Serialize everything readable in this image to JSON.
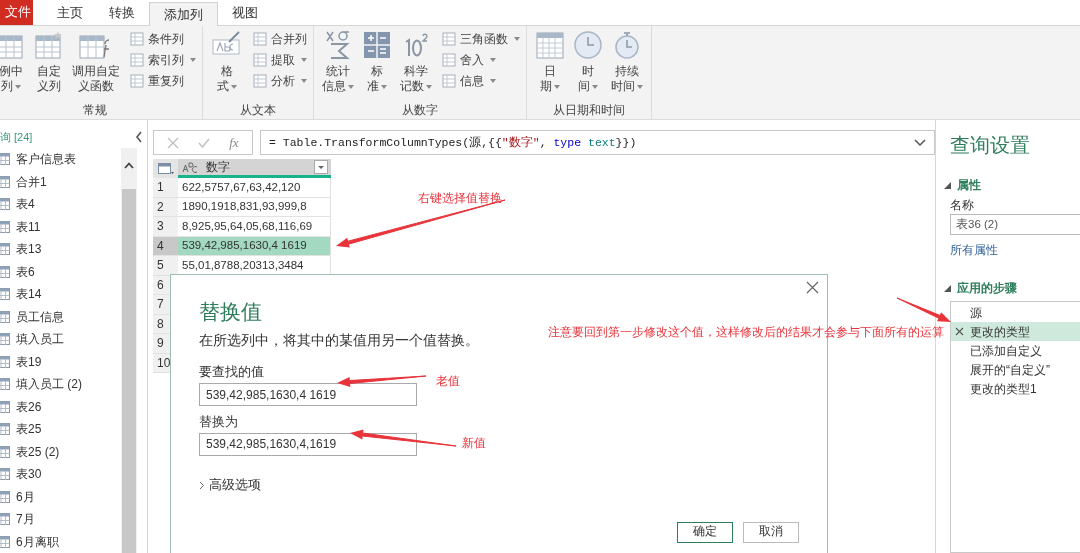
{
  "tabs": [
    {
      "label": "文件",
      "kind": "file",
      "selected": false
    },
    {
      "label": "主页",
      "kind": "tab",
      "selected": false
    },
    {
      "label": "转换",
      "kind": "tab",
      "selected": false
    },
    {
      "label": "添加列",
      "kind": "tab",
      "selected": true
    },
    {
      "label": "视图",
      "kind": "tab",
      "selected": false
    }
  ],
  "ribbon": {
    "groups": [
      {
        "label": "常规",
        "items": [
          {
            "kind": "large",
            "lines": [
              "例中",
              "列"
            ],
            "dropdown": true
          },
          {
            "kind": "large",
            "lines": [
              "自定",
              "义列"
            ],
            "dropdown": false
          },
          {
            "kind": "large",
            "lines": [
              "调用自定",
              "义函数"
            ],
            "dropdown": false
          },
          {
            "kind": "stack",
            "items": [
              {
                "label": "条件列",
                "dropdown": false
              },
              {
                "label": "索引列",
                "dropdown": true
              },
              {
                "label": "重复列",
                "dropdown": false
              }
            ]
          }
        ]
      },
      {
        "label": "从文本",
        "items": [
          {
            "kind": "large",
            "lines": [
              "格",
              "式"
            ],
            "dropdown": true
          },
          {
            "kind": "stack",
            "items": [
              {
                "label": "合并列",
                "dropdown": false
              },
              {
                "label": "提取",
                "dropdown": true
              },
              {
                "label": "分析",
                "dropdown": true
              }
            ]
          }
        ]
      },
      {
        "label": "从数字",
        "items": [
          {
            "kind": "large",
            "lines": [
              "统计",
              "信息"
            ],
            "dropdown": true
          },
          {
            "kind": "large",
            "lines": [
              "标",
              "准"
            ],
            "dropdown": true
          },
          {
            "kind": "large",
            "lines": [
              "科学",
              "记数"
            ],
            "dropdown": true
          },
          {
            "kind": "stack",
            "items": [
              {
                "label": "三角函数",
                "dropdown": true
              },
              {
                "label": "舍入",
                "dropdown": true
              },
              {
                "label": "信息",
                "dropdown": true
              }
            ]
          }
        ]
      },
      {
        "label": "从日期和时间",
        "items": [
          {
            "kind": "large",
            "lines": [
              "日",
              "期"
            ],
            "dropdown": true
          },
          {
            "kind": "large",
            "lines": [
              "时",
              "间"
            ],
            "dropdown": true
          },
          {
            "kind": "large",
            "lines": [
              "持续",
              "时间"
            ],
            "dropdown": true
          }
        ]
      }
    ]
  },
  "queries": {
    "header": "询 [24]",
    "items": [
      "客户信息表",
      "合并1",
      "表4",
      "表11",
      "表13",
      "表6",
      "表14",
      "员工信息",
      "填入员工",
      "表19",
      "填入员工 (2)",
      "表26",
      "表25",
      "表25 (2)",
      "表30",
      "6月",
      "7月",
      "6月离职"
    ]
  },
  "formula_bar": {
    "fx_label": "fx",
    "formula": [
      {
        "kind": "plain",
        "text": "= Table.TransformColumnTypes(源,{{"
      },
      {
        "kind": "string",
        "text": "\"数字\""
      },
      {
        "kind": "plain",
        "text": ", "
      },
      {
        "kind": "keyword",
        "text": "type"
      },
      {
        "kind": "type",
        "text": " text"
      },
      {
        "kind": "plain",
        "text": "}})"
      }
    ]
  },
  "table": {
    "column": "数字",
    "rows": [
      {
        "number": "1",
        "value": "622,5757,67,63,42,120",
        "selected": false
      },
      {
        "number": "2",
        "value": "1890,1918,831,93,999,8",
        "selected": false
      },
      {
        "number": "3",
        "value": "8,925,95,64,05,68,116,69",
        "selected": false
      },
      {
        "number": "4",
        "value": "539,42,985,1630,4 1619",
        "selected": true
      },
      {
        "number": "5",
        "value": "55,01,8788,20313,3484",
        "selected": false
      },
      {
        "number": "6",
        "selected": false
      },
      {
        "number": "7",
        "selected": false
      },
      {
        "number": "8",
        "selected": false
      },
      {
        "number": "9",
        "selected": false
      },
      {
        "number": "10",
        "selected": false
      }
    ]
  },
  "dialog": {
    "title": "替换值",
    "description": "在所选列中，将其中的某值用另一个值替换。",
    "find_label": "要查找的值",
    "find_value": "539,42,985,1630,4 1619",
    "replace_label": "替换为",
    "replace_value": "539,42,985,1630,4,1619",
    "advanced": "高级选项",
    "buttons": [
      {
        "label": "确定",
        "kind": "primary"
      },
      {
        "label": "取消",
        "kind": "secondary"
      }
    ]
  },
  "query_settings": {
    "title": "查询设置",
    "properties_heading": "属性",
    "name_label": "名称",
    "name_value": "表36 (2)",
    "all_properties": "所有属性",
    "steps_heading": "应用的步骤",
    "steps": [
      {
        "label": "源",
        "selected": false
      },
      {
        "label": "更改的类型",
        "selected": true
      },
      {
        "label": "已添加自定义",
        "selected": false
      },
      {
        "label": "展开的“自定义”",
        "selected": false
      },
      {
        "label": "更改的类型1",
        "selected": false
      }
    ]
  },
  "annotations": [
    {
      "text": "右键选择值替换"
    },
    {
      "text": "注意要回到第一步修改这个值，这样修改后的结果才会参与下面所有的运算"
    },
    {
      "text": "老值"
    },
    {
      "text": "新值"
    }
  ]
}
